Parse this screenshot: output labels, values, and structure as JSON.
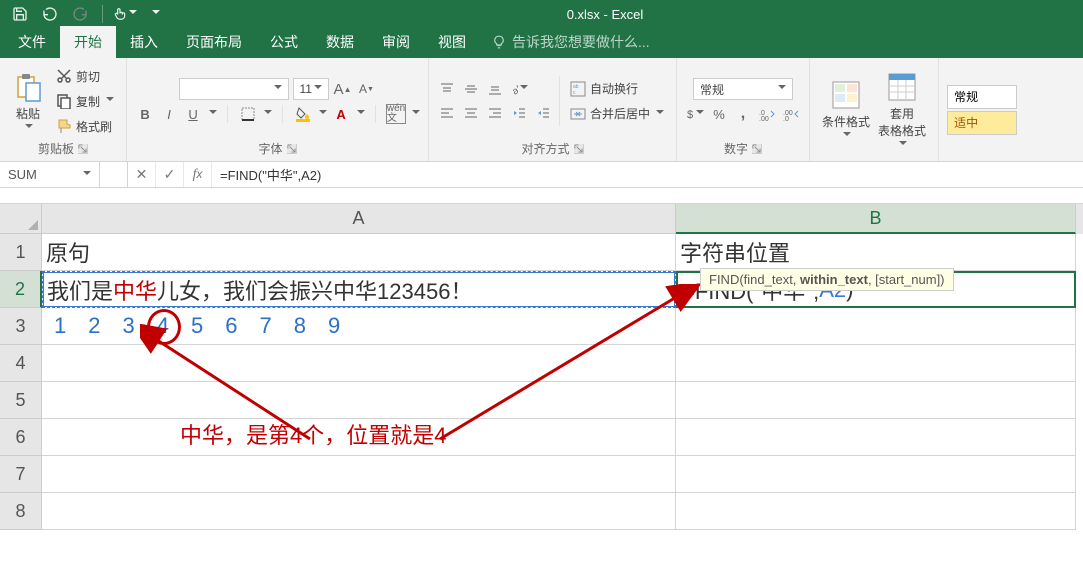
{
  "app": {
    "title": "0.xlsx - Excel"
  },
  "tabs": {
    "file": "文件",
    "home": "开始",
    "insert": "插入",
    "layout": "页面布局",
    "formulas": "公式",
    "data": "数据",
    "review": "审阅",
    "view": "视图",
    "tell": "告诉我您想要做什么..."
  },
  "ribbon": {
    "clipboard": {
      "label": "剪贴板",
      "paste": "粘贴",
      "cut": "剪切",
      "copy": "复制",
      "painter": "格式刷"
    },
    "font": {
      "label": "字体",
      "size": "11",
      "bold": "B",
      "italic": "I",
      "underline": "U"
    },
    "align": {
      "label": "对齐方式",
      "wrap": "自动换行",
      "merge": "合并后居中"
    },
    "number": {
      "label": "数字",
      "format": "常规"
    },
    "styles": {
      "cond": "条件格式",
      "table": "套用\n表格格式"
    },
    "cells": {
      "normal": "常规",
      "moderate": "适中"
    }
  },
  "formulabar": {
    "name": "SUM",
    "formula": "=FIND(\"中华\",A2)"
  },
  "sheet": {
    "cols": {
      "A": "A",
      "B": "B"
    },
    "rows": [
      "1",
      "2",
      "3",
      "4",
      "5",
      "6",
      "7",
      "8"
    ],
    "A1": "原句",
    "A2_pre": "我们是",
    "A2_red": "中华",
    "A2_post": "儿女，我们会振兴中华123456！",
    "A3_nums": [
      "1",
      "2",
      "3",
      "4",
      "5",
      "6",
      "7",
      "8",
      "9"
    ],
    "B1": "字符串位置",
    "B2_formula": "=FIND(\"中华\",",
    "B2_ref": "A2",
    "B2_end": ")",
    "tooltip_pre": "FIND(find_text, ",
    "tooltip_bold": "within_text",
    "tooltip_post": ", [start_num])",
    "annotation": "中华，是第4个，位置就是4"
  }
}
